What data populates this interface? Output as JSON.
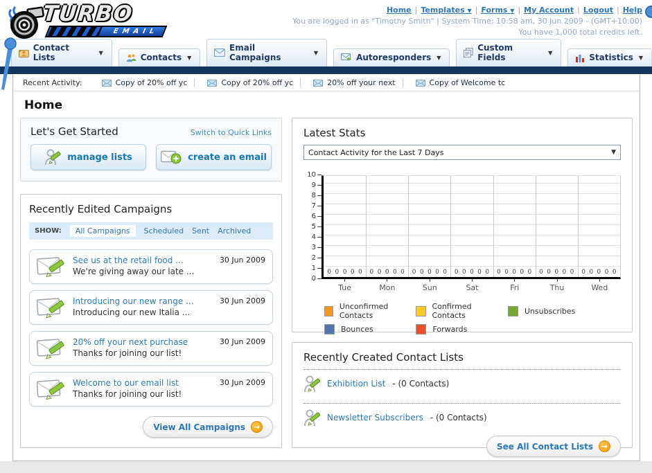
{
  "header": {
    "logo_line1": "TURBO",
    "logo_line2": "EMAIL",
    "nav_links": [
      {
        "label": "Home"
      },
      {
        "label": "Templates"
      },
      {
        "label": "Forms"
      },
      {
        "label": "My Account"
      },
      {
        "label": "Logout"
      },
      {
        "label": "Help"
      }
    ],
    "login_info": "You are logged in as \"Timothy Smith\" | System Time: 10:58 am, 30 Jun 2009 - (GMT+10:00)",
    "credits_info": "You have 1,000 total credits left."
  },
  "tabs": [
    {
      "label": "Contact Lists"
    },
    {
      "label": "Contacts"
    },
    {
      "label": "Email Campaigns"
    },
    {
      "label": "Autoresponders"
    },
    {
      "label": "Custom Fields"
    },
    {
      "label": "Statistics"
    }
  ],
  "recent_activity": {
    "label": "Recent Activity:",
    "items": [
      "Copy of 20% off yc",
      "Copy of 20% off yc",
      "20% off your next",
      "Copy of Welcome tc"
    ]
  },
  "page_title": "Home",
  "get_started": {
    "title": "Let's Get Started",
    "switch_link": "Switch to Quick Links",
    "manage_lists_label": "manage lists",
    "create_email_label": "create an email"
  },
  "campaigns": {
    "title": "Recently Edited Campaigns",
    "show_label": "SHOW:",
    "filters": [
      "All Campaigns",
      "Scheduled",
      "Sent",
      "Archived"
    ],
    "active_filter": "All Campaigns",
    "items": [
      {
        "title": "See us at the retail food ...",
        "subtitle": "We're giving away our late ...",
        "date": "30 Jun 2009"
      },
      {
        "title": "Introducing our new range ...",
        "subtitle": "Introducing our new Italia ...",
        "date": "30 Jun 2009"
      },
      {
        "title": "20% off your next purchase",
        "subtitle": "Thanks for joining our list!",
        "date": "30 Jun 2009"
      },
      {
        "title": "Welcome to our email list",
        "subtitle": "Thanks for joining our list!",
        "date": "30 Jun 2009"
      }
    ],
    "view_all_label": "View All Campaigns"
  },
  "latest_stats": {
    "title": "Latest Stats",
    "dropdown_value": "Contact Activity for the Last 7 Days"
  },
  "chart_data": {
    "type": "bar",
    "title": "Contact Activity for the Last 7 Days",
    "categories": [
      "Tue",
      "Mon",
      "Sun",
      "Sat",
      "Fri",
      "Thu",
      "Wed"
    ],
    "series": [
      {
        "name": "Unconfirmed Contacts",
        "color": "#F7941E",
        "values": [
          0,
          0,
          0,
          0,
          0,
          0,
          0
        ]
      },
      {
        "name": "Confirmed Contacts",
        "color": "#FCCA28",
        "values": [
          0,
          0,
          0,
          0,
          0,
          0,
          0
        ]
      },
      {
        "name": "Unsubscribes",
        "color": "#76A832",
        "values": [
          0,
          0,
          0,
          0,
          0,
          0,
          0
        ]
      },
      {
        "name": "Bounces",
        "color": "#5574A7",
        "values": [
          0,
          0,
          0,
          0,
          0,
          0,
          0
        ]
      },
      {
        "name": "Forwards",
        "color": "#E8502F",
        "values": [
          0,
          0,
          0,
          0,
          0,
          0,
          0
        ]
      }
    ],
    "ylim": [
      0,
      10
    ],
    "yticks": [
      0,
      1,
      2,
      3,
      4,
      5,
      6,
      7,
      8,
      9,
      10
    ],
    "grid": true,
    "legend_position": "bottom",
    "value_labels_shown": true
  },
  "contact_lists": {
    "title": "Recently Created Contact Lists",
    "items": [
      {
        "name": "Exhibition List",
        "detail": "- (0 Contacts)"
      },
      {
        "name": "Newsletter Subscribers",
        "detail": "- (0 Contacts)"
      }
    ],
    "see_all_label": "See All Contact Lists"
  },
  "colors": {
    "navy_bar": "#14375f",
    "link_blue": "#2d77b4",
    "accent_orange": "#f6a21d",
    "pencil_green": "#8dc63f"
  }
}
